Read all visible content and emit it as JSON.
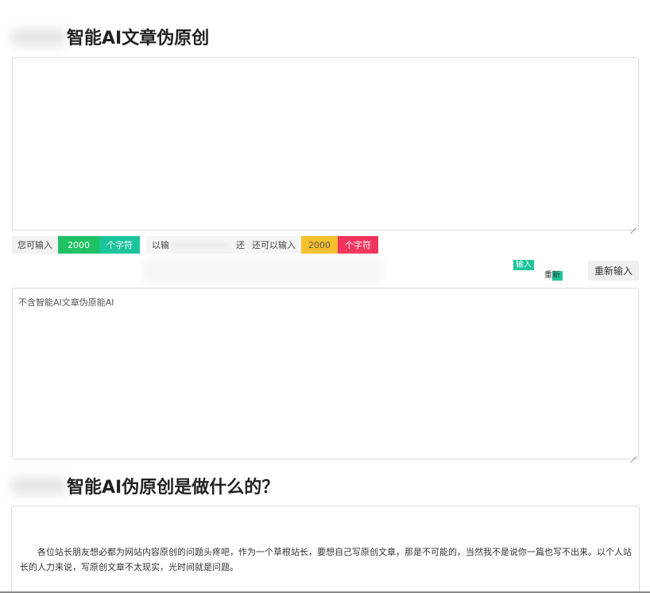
{
  "section1": {
    "title": "智能AI文章伪原创"
  },
  "input": {
    "placeholder": "",
    "value": ""
  },
  "stats": {
    "can_input_label": "您可输入",
    "max_count": "2000",
    "chars_unit": "个字符",
    "entered_label": "以输",
    "remaining_mid": "还",
    "remaining_label": "还可以输入",
    "remaining_count": "2000",
    "remaining_unit": "个字符"
  },
  "actions": {
    "submit_top": "输入",
    "submit_bottom": "重新",
    "reset_label": "重新输入"
  },
  "output": {
    "placeholder": "不含智能AI文章伪原能AI"
  },
  "section2": {
    "title": "智能AI伪原创是做什么的？",
    "paragraph": "各位站长朋友想必都为网站内容原创的问题头疼吧，作为一个草根站长，要想自己写原创文章，那是不可能的，当然我不是说你一篇也写不出来。以个人站长的人力来说，写原创文章不太现实，光时间就是问题。"
  },
  "colors": {
    "green": "#1fc162",
    "teal": "#1bc49b",
    "yellow": "#f6c12e",
    "red": "#f2335c"
  }
}
